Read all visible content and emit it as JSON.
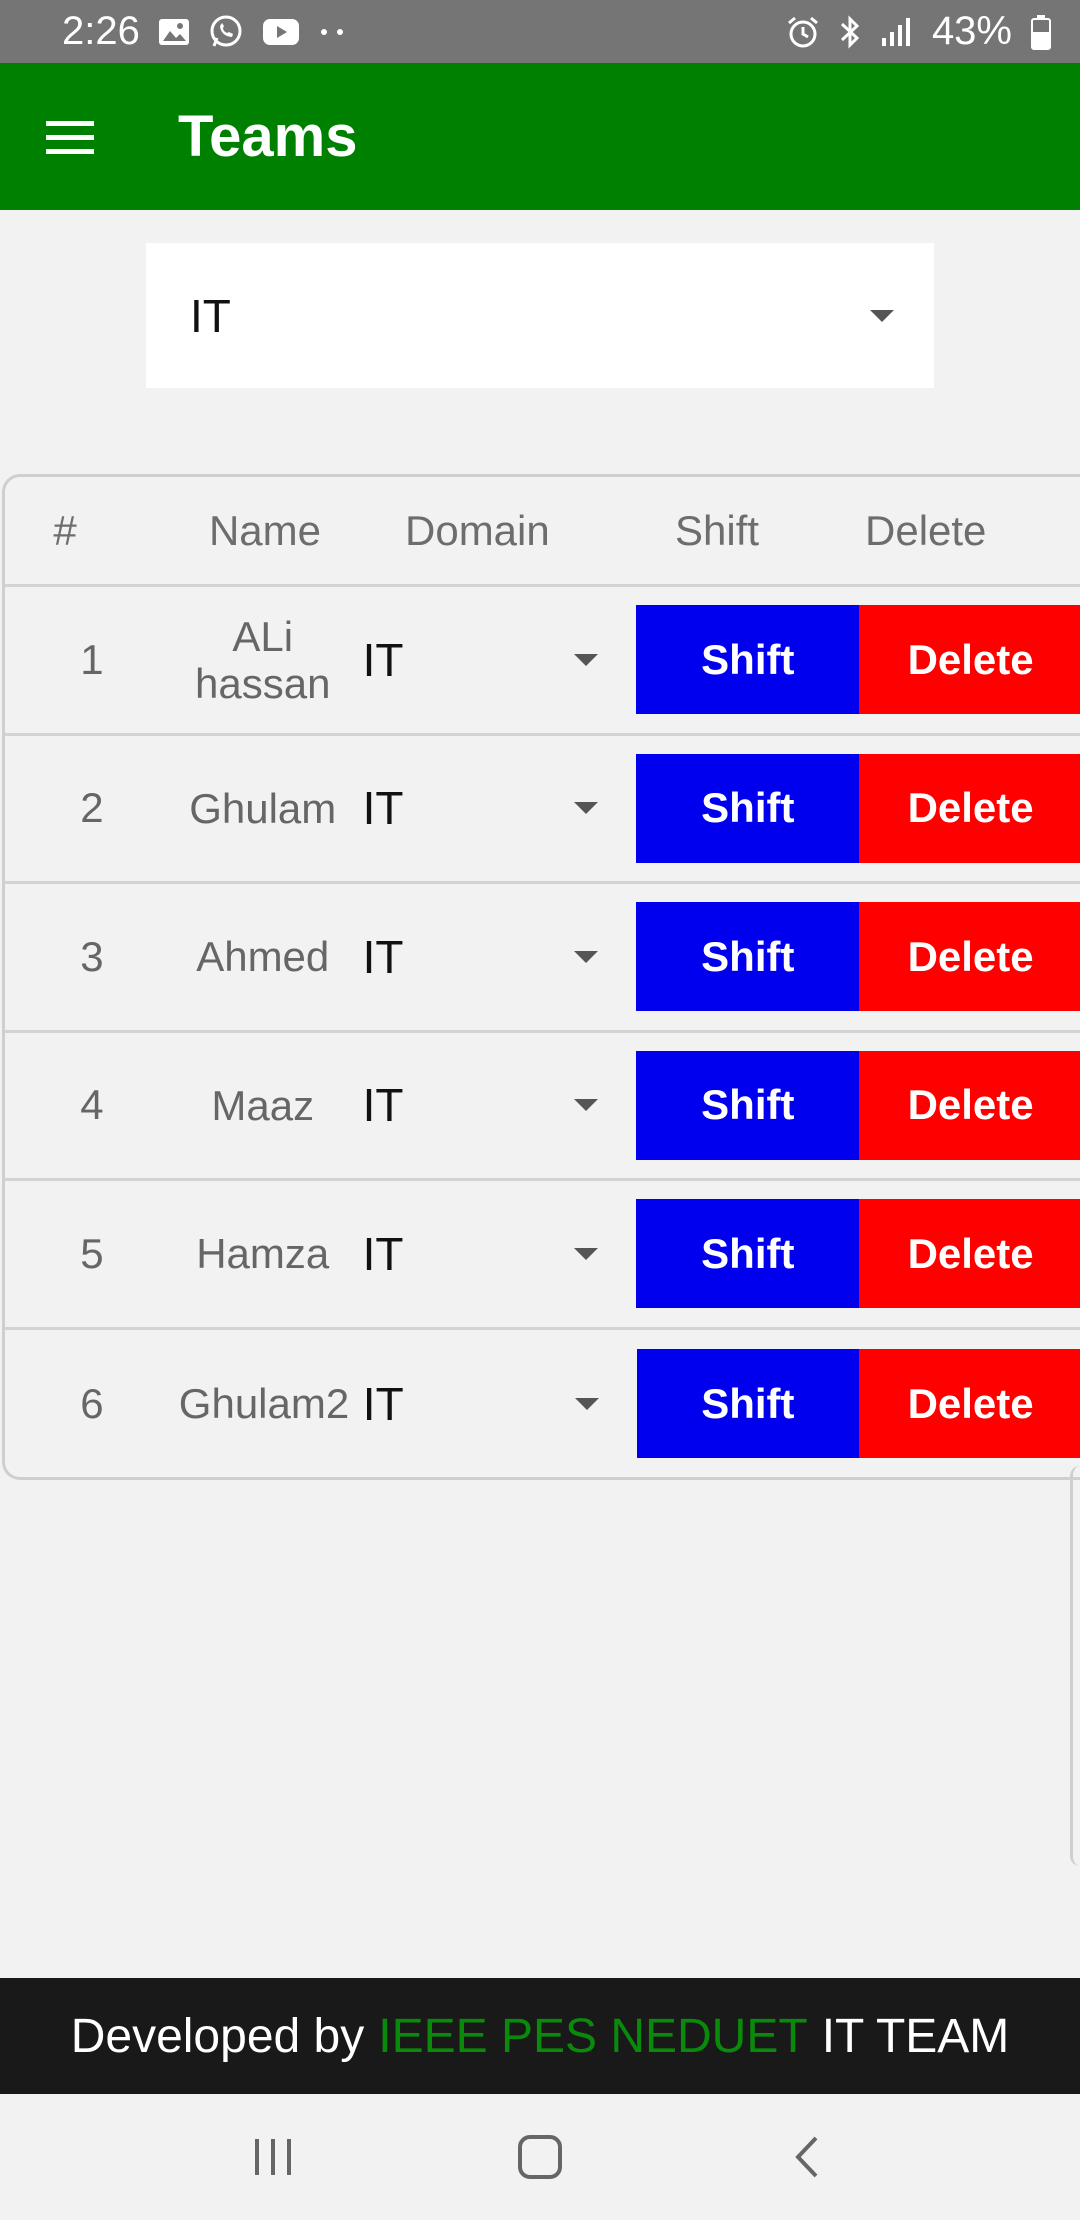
{
  "status_bar": {
    "time": "2:26",
    "battery": "43%",
    "left_icons": [
      "gallery-icon",
      "whatsapp-icon",
      "youtube-icon",
      "more-dots-icon"
    ],
    "right_icons": [
      "alarm-icon",
      "bluetooth-icon",
      "signal-icon",
      "battery-icon"
    ]
  },
  "app_bar": {
    "title": "Teams",
    "color": "#008000"
  },
  "team_select": {
    "value": "IT"
  },
  "table": {
    "headers": {
      "num": "#",
      "name": "Name",
      "domain": "Domain",
      "shift": "Shift",
      "delete": "Delete"
    },
    "rows": [
      {
        "num": "1",
        "name": "ALi hassan",
        "domain": "IT",
        "shift": "Shift",
        "delete": "Delete"
      },
      {
        "num": "2",
        "name": "Ghulam",
        "domain": "IT",
        "shift": "Shift",
        "delete": "Delete"
      },
      {
        "num": "3",
        "name": "Ahmed",
        "domain": "IT",
        "shift": "Shift",
        "delete": "Delete"
      },
      {
        "num": "4",
        "name": "Maaz",
        "domain": "IT",
        "shift": "Shift",
        "delete": "Delete"
      },
      {
        "num": "5",
        "name": "Hamza",
        "domain": "IT",
        "shift": "Shift",
        "delete": "Delete"
      },
      {
        "num": "6",
        "name": "Ghulam2",
        "domain": "IT",
        "shift": "Shift",
        "delete": "Delete"
      }
    ],
    "shift_color": "#0000ee",
    "delete_color": "#ff0000"
  },
  "footer": {
    "prefix": "Developed by",
    "org": "IEEE PES NEDUET",
    "suffix": "IT TEAM",
    "org_color": "#0a8a0a"
  },
  "nav_bar": {
    "icons": [
      "recent-apps-icon",
      "home-icon",
      "back-icon"
    ]
  }
}
